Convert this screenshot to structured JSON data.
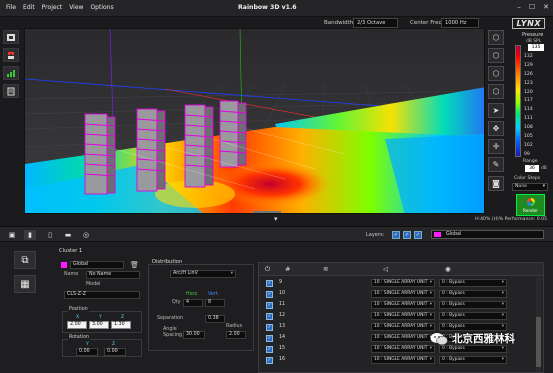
{
  "window": {
    "title": "Rainbow 3D v1.6",
    "menu": [
      "File",
      "Edit",
      "Project",
      "View",
      "Options"
    ],
    "controls": [
      "–",
      "☐",
      "✕"
    ]
  },
  "toolbar": {
    "bandwidth_label": "Bandwidth",
    "bandwidth_value": "2/3 Octave",
    "center_freq_label": "Center Freq",
    "center_freq_value": "1000 Hz",
    "brand": "LYNX"
  },
  "scale": {
    "title": "Pressure",
    "unit": "dB SPL",
    "max_value": "135",
    "ticks": [
      "135",
      "132",
      "129",
      "126",
      "123",
      "120",
      "117",
      "114",
      "111",
      "108",
      "105",
      "102",
      "99"
    ],
    "range_label": "Range",
    "range_value": "36",
    "range_unit": "dB",
    "steps_label": "Color Steps",
    "steps_value": "None",
    "render_label": "Render",
    "colors": {
      "high": "#b0003a",
      "low": "#1c1aa8"
    }
  },
  "status": {
    "text": "H:40% (H)%   Performance: 0.05"
  },
  "bottom": {
    "layers_label": "Layers:",
    "layer_name": "Global",
    "layer_color": "#ff1aff",
    "cluster": {
      "title": "Cluster 1",
      "global_label": "Global",
      "name_label": "Name",
      "name_value": "No Name",
      "model_label": "Model",
      "model_value": "CLS-Z-Z",
      "position_title": "Position",
      "position_axes": [
        "X",
        "Y",
        "Z"
      ],
      "position_values": [
        "2.00",
        "3.00",
        "1.30"
      ],
      "rotation_title": "Rotation",
      "rotation_axes": [
        "Y",
        "Z"
      ],
      "rotation_values": [
        "0.00",
        "0.00"
      ]
    },
    "distribution": {
      "title": "Distribution",
      "mode": "Arc/H LinV",
      "horz_label": "Horz.",
      "vert_label": "Vert.",
      "qty_label": "Qty",
      "qty_horz": "4",
      "qty_vert": "8",
      "separation_label": "Separation",
      "separation_value": "0.38",
      "radius_label": "Radius",
      "radius_value": "2.00",
      "angle_label": "Angle\nSpacing",
      "angle_value": "30.00"
    },
    "array_rows": [
      {
        "num": "9",
        "unit": "10 : SINGLE ARRAY UNIT",
        "eq": "0 : Bypass"
      },
      {
        "num": "10",
        "unit": "10 : SINGLE ARRAY UNIT",
        "eq": "0 : Bypass"
      },
      {
        "num": "11",
        "unit": "10 : SINGLE ARRAY UNIT",
        "eq": "0 : Bypass"
      },
      {
        "num": "12",
        "unit": "10 : SINGLE ARRAY UNIT",
        "eq": "0 : Bypass"
      },
      {
        "num": "13",
        "unit": "10 : SINGLE ARRAY UNIT",
        "eq": "0 : Bypass"
      },
      {
        "num": "14",
        "unit": "10 : SINGLE ARRAY UNIT",
        "eq": "0 : Bypass"
      },
      {
        "num": "15",
        "unit": "10 : SINGLE ARRAY UNIT",
        "eq": "0 : Bypass"
      },
      {
        "num": "16",
        "unit": "10 : SINGLE ARRAY UNIT",
        "eq": "0 : Bypass"
      }
    ]
  },
  "watermark": "北京西雅林科"
}
